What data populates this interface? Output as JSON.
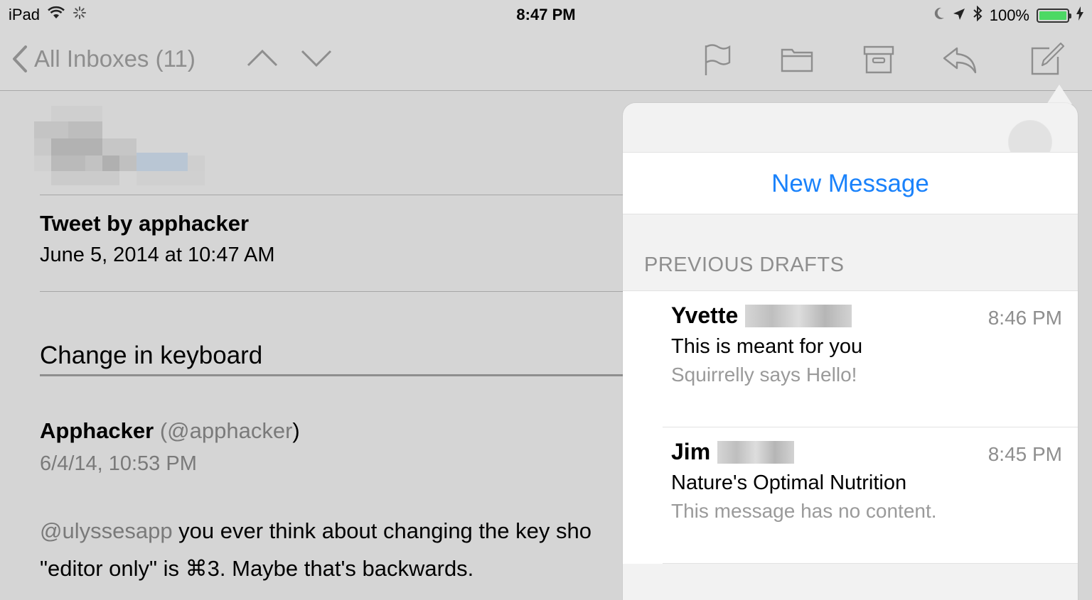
{
  "status_bar": {
    "device": "iPad",
    "time": "8:47 PM",
    "battery": "100%",
    "battery_level": 1.0
  },
  "toolbar": {
    "back_label": "All Inboxes (11)",
    "icons": [
      "chevron-up-icon",
      "chevron-down-icon",
      "flag-icon",
      "folder-icon",
      "archive-icon",
      "reply-icon",
      "compose-icon"
    ]
  },
  "message": {
    "subject": "Tweet by apphacker",
    "date": "June 5, 2014 at 10:47 AM",
    "headline": "Change in keyboard",
    "author_name": "Apphacker",
    "author_handle_open": " (",
    "author_handle": "@apphacker",
    "author_handle_close": ")",
    "tweet_time": "6/4/14, 10:53 PM",
    "tweet_mention": "@ulyssesapp",
    "tweet_line1_rest": " you ever think about changing the key sho",
    "tweet_line2": "\"editor only\" is ⌘3. Maybe that's backwards."
  },
  "popover": {
    "new_message": "New Message",
    "drafts_header": "PREVIOUS DRAFTS",
    "drafts": [
      {
        "name": "Yvette",
        "time": "8:46 PM",
        "subject": "This is meant for you",
        "preview": "Squirrelly says Hello!"
      },
      {
        "name": "Jim",
        "time": "8:45 PM",
        "subject": "Nature's Optimal Nutrition",
        "preview": "This message has no content."
      }
    ]
  },
  "colors": {
    "accent": "#1a82fb",
    "background": "#d5d5d5",
    "battery": "#4cd964"
  }
}
